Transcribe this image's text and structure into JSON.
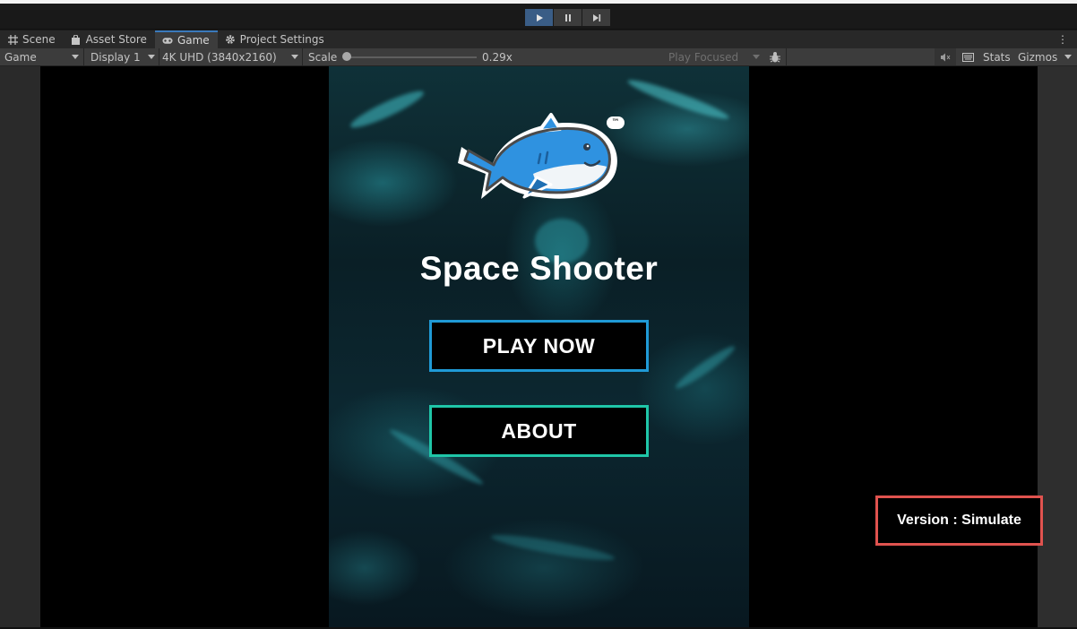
{
  "editor": {
    "play_controls": {
      "play_icon": "play-icon",
      "pause_icon": "pause-icon",
      "step_icon": "step-icon"
    },
    "tabs": [
      {
        "label": "Scene",
        "icon": "grid-icon"
      },
      {
        "label": "Asset Store",
        "icon": "bag-icon"
      },
      {
        "label": "Game",
        "icon": "gamepad-icon",
        "active": true
      },
      {
        "label": "Project Settings",
        "icon": "gear-icon"
      }
    ],
    "tab_menu_label": "⋮",
    "game_toolbar": {
      "view_mode": "Game",
      "display": "Display 1",
      "resolution": "4K UHD (3840x2160)",
      "scale_label": "Scale",
      "scale_value": "0.29x",
      "play_focused": "Play Focused",
      "stats": "Stats",
      "gizmos": "Gizmos"
    }
  },
  "game": {
    "logo_mark": "™",
    "title": "Space Shooter",
    "play_button": "PLAY NOW",
    "about_button": "ABOUT",
    "version_text": "Version : Simulate"
  },
  "colors": {
    "play_active": "#3a5d86",
    "play_button_border": "#1f9ad6",
    "about_button_border": "#1fc6a8",
    "version_border": "#e0534f",
    "shark_blue": "#2f92e0"
  }
}
